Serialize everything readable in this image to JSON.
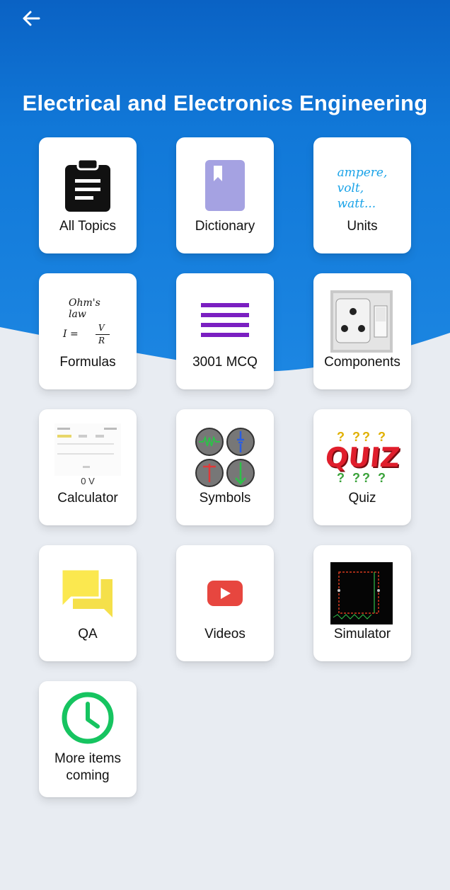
{
  "header": {
    "back_icon": "arrow-left-icon",
    "title": "Electrical and Electronics Engineering",
    "colors": {
      "blue_top": "#0a6fd0",
      "blue_mid": "#1c86e2",
      "background": "#e8ecf2"
    }
  },
  "tiles": [
    {
      "label": "All Topics",
      "icon": "clipboard-icon"
    },
    {
      "label": "Dictionary",
      "icon": "book-icon"
    },
    {
      "label": "Units",
      "icon": "units-text-icon",
      "icon_lines": [
        "ampere,",
        "volt,",
        "watt..."
      ]
    },
    {
      "label": "Formulas",
      "icon": "ohms-law-icon",
      "icon_title": "Ohm's law",
      "icon_formula_left": "I =",
      "icon_num": "V",
      "icon_den": "R"
    },
    {
      "label": "3001 MCQ",
      "icon": "list-lines-icon"
    },
    {
      "label": "Components",
      "icon": "socket-switch-icon"
    },
    {
      "label": "Calculator",
      "icon": "calculator-screenshot-icon",
      "icon_value": "0 V"
    },
    {
      "label": "Symbols",
      "icon": "circuit-symbols-icon"
    },
    {
      "label": "Quiz",
      "icon": "quiz-icon",
      "icon_word": "QUIZ",
      "icon_marks": "? ?? ?"
    },
    {
      "label": "QA",
      "icon": "chat-bubbles-icon"
    },
    {
      "label": "Videos",
      "icon": "video-play-icon"
    },
    {
      "label": "Simulator",
      "icon": "simulator-circuit-icon"
    },
    {
      "label": "More items coming",
      "icon": "clock-icon"
    }
  ]
}
